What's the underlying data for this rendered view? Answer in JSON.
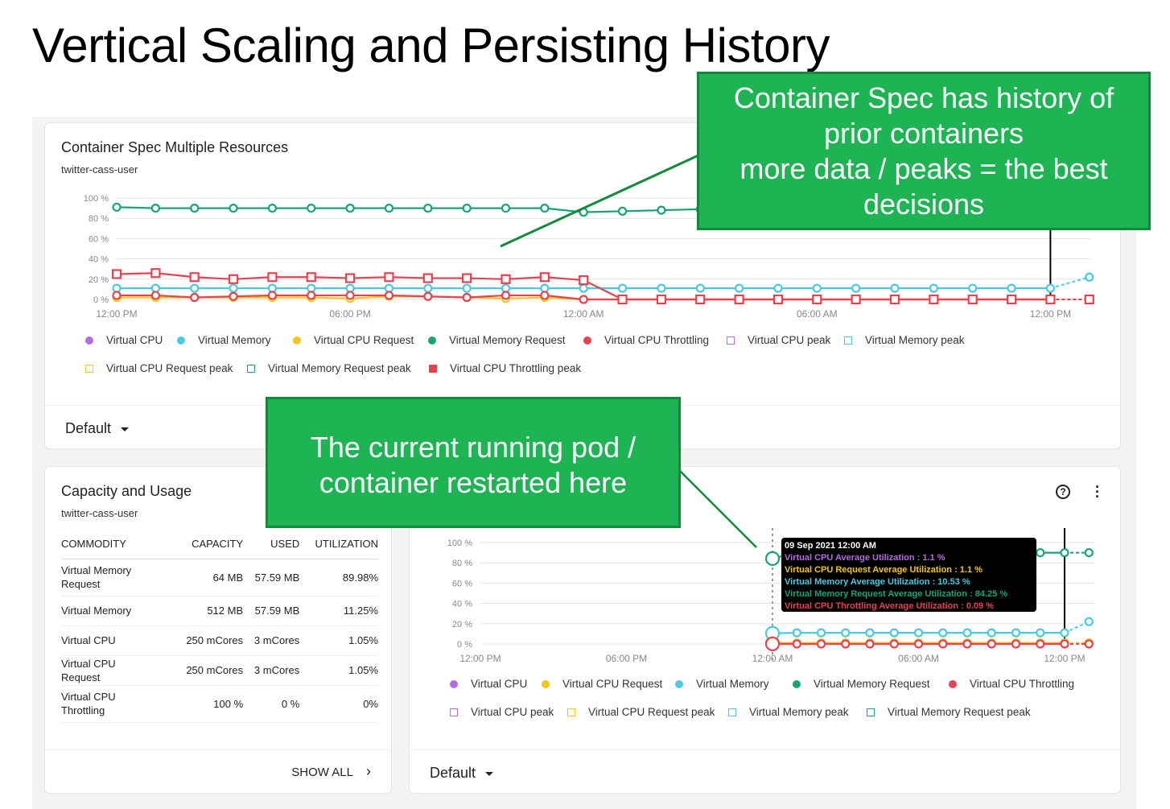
{
  "title": "Vertical Scaling and Persisting History",
  "colors": {
    "cpu": "#b36ae2",
    "cpu_request": "#f5c518",
    "memory": "#4ac9e3",
    "memory_request": "#17a47a",
    "throttling": "#e8414f",
    "callout": "#1eb454"
  },
  "callouts": {
    "top": [
      "Container Spec has history of",
      "prior containers",
      "more data / peaks = the best",
      "decisions"
    ],
    "middle": [
      "The current running pod /",
      "container restarted here"
    ]
  },
  "spec_card": {
    "title": "Container Spec Multiple Resources",
    "subtitle": "twitter-cass-user",
    "dropdown": "Default",
    "legend": [
      {
        "label": "Virtual CPU",
        "shape": "dot",
        "color": "#b36ae2"
      },
      {
        "label": "Virtual Memory",
        "shape": "dot",
        "color": "#4ac9e3"
      },
      {
        "label": "Virtual CPU Request",
        "shape": "dot",
        "color": "#f5c518"
      },
      {
        "label": "Virtual Memory Request",
        "shape": "dot",
        "color": "#17a47a"
      },
      {
        "label": "Virtual CPU Throttling",
        "shape": "dot",
        "color": "#e8414f"
      },
      {
        "label": "Virtual CPU peak",
        "shape": "square",
        "color": "#b36ae2"
      },
      {
        "label": "Virtual Memory peak",
        "shape": "square",
        "color": "#4ac9e3"
      },
      {
        "label": "Virtual CPU Request peak",
        "shape": "square",
        "color": "#f5c518"
      },
      {
        "label": "Virtual Memory Request peak",
        "shape": "square",
        "color": "#17a47a"
      },
      {
        "label": "Virtual CPU Throttling peak",
        "shape": "filled-square",
        "color": "#e8414f"
      }
    ]
  },
  "capacity_card": {
    "title": "Capacity and Usage",
    "subtitle": "twitter-cass-user",
    "columns": [
      "COMMODITY",
      "CAPACITY",
      "USED",
      "UTILIZATION"
    ],
    "rows": [
      [
        "Virtual Memory Request",
        "64 MB",
        "57.59 MB",
        "89.98%"
      ],
      [
        "Virtual Memory",
        "512 MB",
        "57.59 MB",
        "11.25%"
      ],
      [
        "Virtual CPU",
        "250 mCores",
        "3 mCores",
        "1.05%"
      ],
      [
        "Virtual CPU Request",
        "250 mCores",
        "3 mCores",
        "1.05%"
      ],
      [
        "Virtual CPU Throttling",
        "100 %",
        "0 %",
        "0%"
      ]
    ],
    "show_all": "SHOW ALL"
  },
  "usage_card": {
    "dropdown": "Default",
    "help_icon": "question-circle-icon",
    "menu_icon": "more-vertical-icon",
    "tooltip": {
      "header": "09 Sep 2021 12:00 AM",
      "lines": [
        {
          "text": "Virtual CPU Average Utilization : 1.1 %",
          "color": "#b36ae2"
        },
        {
          "text": "Virtual CPU Request Average Utilization : 1.1 %",
          "color": "#f5c518"
        },
        {
          "text": "Virtual Memory Average Utilization : 10.53 %",
          "color": "#4ac9e3"
        },
        {
          "text": "Virtual Memory Request Average Utilization : 84.25 %",
          "color": "#17a47a"
        },
        {
          "text": "Virtual CPU Throttling Average Utilization : 0.09 %",
          "color": "#e8414f"
        }
      ]
    },
    "legend": [
      {
        "label": "Virtual CPU",
        "shape": "dot",
        "color": "#b36ae2"
      },
      {
        "label": "Virtual CPU Request",
        "shape": "dot",
        "color": "#f5c518"
      },
      {
        "label": "Virtual Memory",
        "shape": "dot",
        "color": "#4ac9e3"
      },
      {
        "label": "Virtual Memory Request",
        "shape": "dot",
        "color": "#17a47a"
      },
      {
        "label": "Virtual CPU Throttling",
        "shape": "dot",
        "color": "#e8414f"
      },
      {
        "label": "Virtual CPU peak",
        "shape": "square",
        "color": "#b36ae2"
      },
      {
        "label": "Virtual CPU Request peak",
        "shape": "square",
        "color": "#f5c518"
      },
      {
        "label": "Virtual Memory peak",
        "shape": "square",
        "color": "#4ac9e3"
      },
      {
        "label": "Virtual Memory Request peak",
        "shape": "square",
        "color": "#17a47a"
      }
    ]
  },
  "chart_data": [
    {
      "type": "line",
      "y_ticks": [
        "100 %",
        "80 %",
        "60 %",
        "40 %",
        "20 %",
        "0 %"
      ],
      "ylim": [
        0,
        100
      ],
      "x_ticks": [
        "12:00 PM",
        "06:00 PM",
        "12:00 AM",
        "06:00 AM",
        "12:00 PM"
      ],
      "grid": true,
      "x_hours": [
        0,
        1,
        2,
        3,
        4,
        5,
        6,
        7,
        8,
        9,
        10,
        11,
        12,
        13,
        14,
        15,
        16,
        17,
        18,
        19,
        20,
        21,
        22,
        23,
        24,
        25
      ],
      "series": [
        {
          "key": "cpu_request",
          "marker": "circle",
          "color": "#f5c518",
          "values": [
            2,
            2,
            2,
            2,
            2,
            2,
            1,
            3,
            3,
            2,
            1,
            2,
            0,
            0,
            0,
            0,
            0,
            0,
            0,
            0,
            0,
            0,
            0,
            0,
            0,
            0
          ]
        },
        {
          "key": "memory_request",
          "marker": "circle",
          "color": "#17a47a",
          "values": [
            91,
            90,
            90,
            90,
            90,
            90,
            90,
            90,
            90,
            90,
            90,
            90,
            86,
            87,
            88,
            89,
            89,
            89,
            89,
            89,
            89,
            89,
            89,
            89,
            89,
            89
          ]
        },
        {
          "key": "memory",
          "marker": "circle",
          "color": "#4ac9e3",
          "values": [
            11,
            11,
            11,
            11,
            11,
            11,
            11,
            11,
            11,
            11,
            11,
            11,
            11,
            11,
            11,
            11,
            11,
            11,
            11,
            11,
            11,
            11,
            11,
            11,
            11,
            22
          ]
        },
        {
          "key": "throttling",
          "marker": "circle",
          "color": "#e8414f",
          "values": [
            4,
            4,
            2,
            3,
            4,
            4,
            4,
            4,
            3,
            2,
            4,
            4,
            0,
            0,
            0,
            0,
            0,
            0,
            0,
            0,
            0,
            0,
            0,
            0,
            0,
            0
          ]
        },
        {
          "key": "throttling_peak",
          "marker": "square",
          "color": "#e8414f",
          "values": [
            25,
            26,
            22,
            20,
            22,
            22,
            21,
            22,
            21,
            21,
            20,
            22,
            19,
            0,
            0,
            0,
            0,
            0,
            0,
            0,
            0,
            0,
            0,
            0,
            0,
            0
          ]
        }
      ]
    },
    {
      "type": "line",
      "y_ticks": [
        "100 %",
        "80 %",
        "60 %",
        "40 %",
        "20 %",
        "0 %"
      ],
      "ylim": [
        0,
        100
      ],
      "x_ticks": [
        "12:00 PM",
        "06:00 PM",
        "12:00 AM",
        "06:00 AM",
        "12:00 PM"
      ],
      "grid": true,
      "x_hours": [
        12,
        13,
        14,
        15,
        16,
        17,
        18,
        19,
        20,
        21,
        22,
        23,
        24,
        25
      ],
      "series": [
        {
          "key": "cpu_request",
          "marker": "circle",
          "color": "#f5c518",
          "values": [
            1.1,
            1,
            1,
            1,
            1,
            1,
            1,
            1,
            1,
            1,
            1,
            1,
            1,
            1
          ]
        },
        {
          "key": "memory_request",
          "marker": "circle",
          "color": "#17a47a",
          "values": [
            84.25,
            90,
            90,
            90,
            90,
            90,
            90,
            90,
            90,
            90,
            90,
            90,
            90,
            90
          ]
        },
        {
          "key": "memory",
          "marker": "circle",
          "color": "#4ac9e3",
          "values": [
            10.53,
            11,
            11,
            11,
            11,
            11,
            11,
            11,
            11,
            11,
            11,
            11,
            11,
            22
          ]
        },
        {
          "key": "throttling",
          "marker": "circle",
          "color": "#e8414f",
          "values": [
            0.09,
            0,
            0,
            0,
            0,
            0,
            0,
            0,
            0,
            0,
            0,
            0,
            0,
            0
          ]
        }
      ]
    }
  ]
}
